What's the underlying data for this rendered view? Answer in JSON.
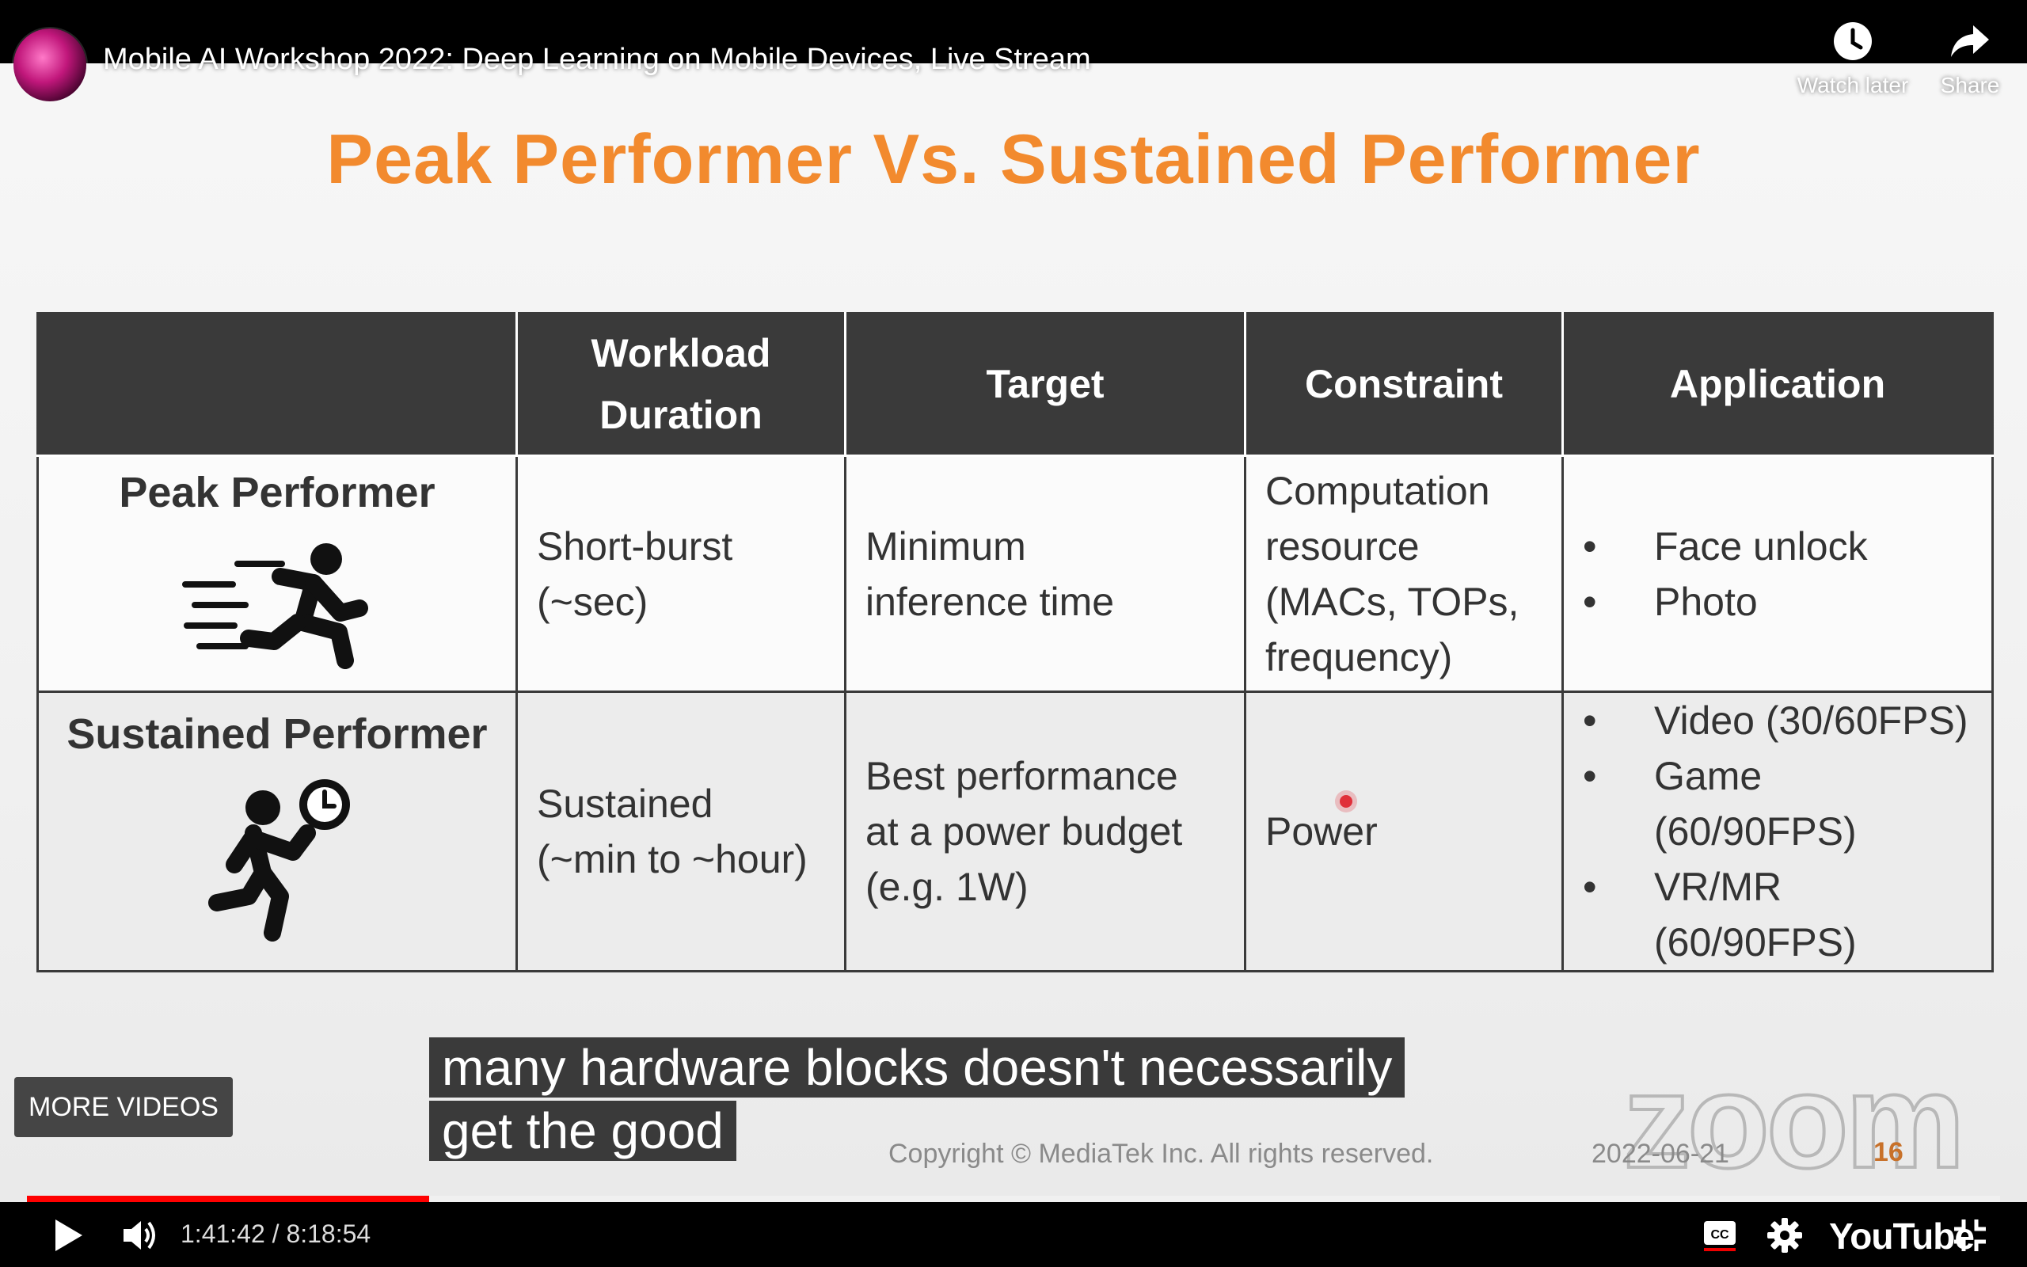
{
  "player": {
    "video_title": "Mobile AI Workshop 2022: Deep Learning on Mobile Devices, Live Stream",
    "watch_later_label": "Watch later",
    "share_label": "Share",
    "more_videos_label": "MORE VIDEOS",
    "current_time": "1:41:42",
    "time_separator": " / ",
    "duration": "8:18:54",
    "progress_fraction": 0.204,
    "youtube_logo": "YouTube",
    "accent_color": "#ff0000"
  },
  "slide": {
    "title": "Peak Performer Vs. Sustained Performer",
    "title_color": "#f28a2e",
    "table": {
      "headers": [
        "",
        "Workload Duration",
        "Target",
        "Constraint",
        "Application"
      ],
      "rows": [
        {
          "name": "Peak Performer",
          "icon": "running-person-icon",
          "workload": [
            "Short-burst",
            "(~sec)"
          ],
          "target": [
            "Minimum",
            "inference time"
          ],
          "constraint": [
            "Computation",
            "resource",
            "(MACs, TOPs,",
            "frequency)"
          ],
          "applications": [
            "Face unlock",
            "Photo"
          ]
        },
        {
          "name": "Sustained Performer",
          "icon": "running-person-clock-icon",
          "workload": [
            "Sustained",
            "(~min to ~hour)"
          ],
          "target": [
            "Best performance",
            "at a power budget",
            "(e.g. 1W)"
          ],
          "constraint": [
            "Power"
          ],
          "applications": [
            "Video (30/60FPS)",
            "Game (60/90FPS)",
            "VR/MR (60/90FPS)"
          ]
        }
      ]
    },
    "copyright": "Copyright © MediaTek Inc. All rights reserved.",
    "date": "2022-06-21",
    "page_number": "16",
    "watermark": "zoom"
  },
  "caption": {
    "line1": "many hardware blocks doesn't necessarily",
    "line2": "get the good"
  }
}
